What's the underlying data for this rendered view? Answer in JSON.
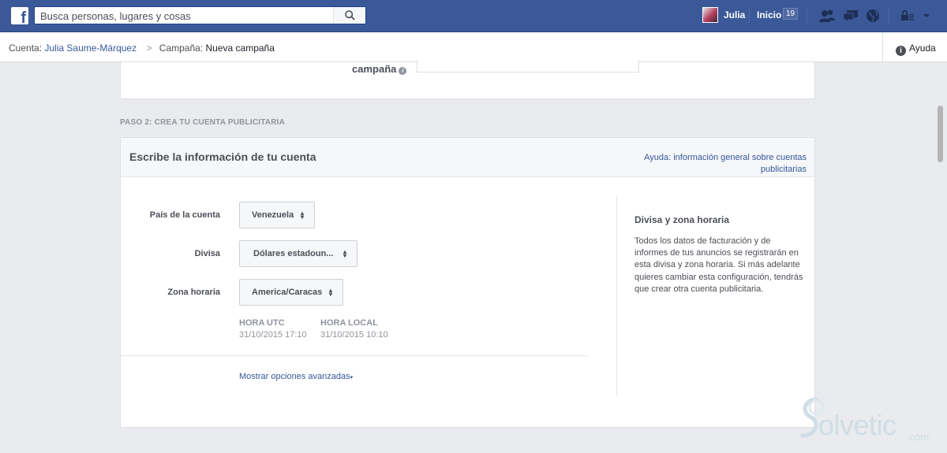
{
  "topbar": {
    "logo": "f",
    "search_placeholder": "Busca personas, lugares y cosas",
    "user_name": "Julia",
    "home_label": "Inicio",
    "home_count": "19",
    "icons": [
      "search-icon",
      "friend-requests-icon",
      "messages-icon",
      "notifications-globe-icon",
      "privacy-lock-icon",
      "account-menu-arrow-icon"
    ]
  },
  "breadcrumb": {
    "account_label": "Cuenta:",
    "account_name": "Julia Saume-Márquez",
    "separator": ">",
    "campaign_label": "Campaña:",
    "campaign_name": "Nueva campaña",
    "help": "Ayuda"
  },
  "previous_section": {
    "field_label": "campaña"
  },
  "step": {
    "title": "PASO 2: CREA TU CUENTA PUBLICITARIA",
    "card_title": "Escribe la información de tu cuenta",
    "help_link": "Ayuda: información general sobre cuentas publicitarias"
  },
  "form": {
    "country_label": "País de la cuenta",
    "country_value": "Venezuela",
    "currency_label": "Divisa",
    "currency_value": "Dólares estadoun...",
    "timezone_label": "Zona horaria",
    "timezone_value": "America/Caracas",
    "utc_header": "HORA UTC",
    "utc_value": "31/10/2015 17:10",
    "local_header": "HORA LOCAL",
    "local_value": "31/10/2015 10:10",
    "advanced_link": "Mostrar opciones avanzadas"
  },
  "sidebar_info": {
    "title": "Divisa y zona horaria",
    "text": "Todos los datos de facturación y de informes de tus anuncios se registrarán en esta divisa y zona horaria. Si más adelante quieres cambiar esta configuración, tendrás que crear otra cuenta publicitaria."
  },
  "watermark": {
    "brand": "olvetic",
    "suffix": ".com"
  },
  "colors": {
    "topbar": "#3b5998",
    "link": "#365899",
    "page_bg": "#e9ebee"
  }
}
